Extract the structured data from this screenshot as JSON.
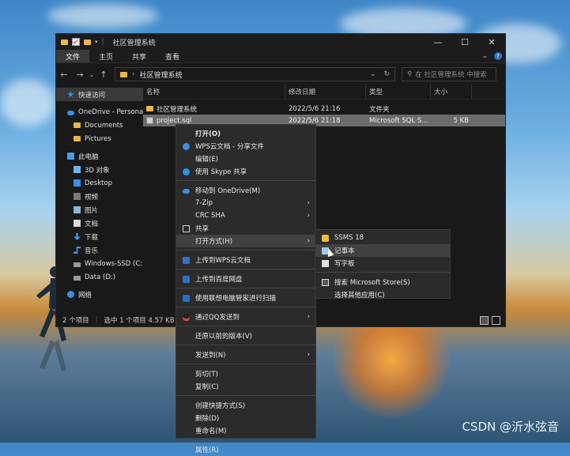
{
  "window": {
    "title": "社区管理系统",
    "controls": {
      "minimize": "—",
      "maximize": "☐",
      "close": "✕"
    }
  },
  "ribbon": {
    "tabs": [
      {
        "label": "文件",
        "active": true
      },
      {
        "label": "主页",
        "active": false
      },
      {
        "label": "共享",
        "active": false
      },
      {
        "label": "查看",
        "active": false
      }
    ]
  },
  "address": {
    "path": "社区管理系统",
    "search_placeholder": "在 社区管理系统 中搜索"
  },
  "nav_pane": {
    "items": [
      {
        "label": "快速访问",
        "icon": "star-icon",
        "selected": true
      },
      {
        "label": "OneDrive - Persona",
        "icon": "cloud-icon",
        "selected": false
      },
      {
        "label": "Documents",
        "icon": "folder-icon",
        "selected": false
      },
      {
        "label": "Pictures",
        "icon": "folder-icon",
        "selected": false
      },
      {
        "label": "此电脑",
        "icon": "computer-icon",
        "selected": false
      },
      {
        "label": "3D 对象",
        "icon": "cube-icon",
        "selected": false
      },
      {
        "label": "Desktop",
        "icon": "desktop-icon",
        "selected": false
      },
      {
        "label": "视频",
        "icon": "video-icon",
        "selected": false
      },
      {
        "label": "图片",
        "icon": "picture-icon",
        "selected": false
      },
      {
        "label": "文档",
        "icon": "document-icon",
        "selected": false
      },
      {
        "label": "下载",
        "icon": "download-icon",
        "selected": false
      },
      {
        "label": "音乐",
        "icon": "music-icon",
        "selected": false
      },
      {
        "label": "Windows-SSD (C:)",
        "icon": "drive-icon",
        "selected": false
      },
      {
        "label": "Data (D:)",
        "icon": "drive-icon",
        "selected": false
      },
      {
        "label": "网络",
        "icon": "network-icon",
        "selected": false
      }
    ]
  },
  "file_list": {
    "columns": [
      "名称",
      "修改日期",
      "类型",
      "大小"
    ],
    "rows": [
      {
        "name": "社区管理系统",
        "date": "2022/5/6 21:16",
        "type": "文件夹",
        "size": "",
        "icon": "folder-icon",
        "selected": false
      },
      {
        "name": "project.sql",
        "date": "2022/5/6 21:18",
        "type": "Microsoft SQL S...",
        "size": "5 KB",
        "icon": "sql-file-icon",
        "selected": true
      }
    ]
  },
  "status": {
    "item_count": "2 个项目",
    "selection": "选中 1 个项目  4.57 KB"
  },
  "context_menu": {
    "items": [
      {
        "label": "打开(O)",
        "bold": true,
        "icon": ""
      },
      {
        "label": "WPS云文档 - 分享文件",
        "icon": "wps-icon"
      },
      {
        "label": "编辑(E)",
        "icon": ""
      },
      {
        "label": "使用 Skype 共享",
        "icon": "skype-icon"
      },
      {
        "sep": true
      },
      {
        "label": "移动到 OneDrive(M)",
        "icon": "cloud-icon"
      },
      {
        "label": "7-Zip",
        "submenu": true,
        "icon": ""
      },
      {
        "label": "CRC SHA",
        "submenu": true,
        "icon": ""
      },
      {
        "label": "共享",
        "icon": "share-icon"
      },
      {
        "label": "打开方式(H)",
        "submenu": true,
        "highlighted": true,
        "icon": ""
      },
      {
        "sep": true
      },
      {
        "label": "上传到WPS云文档",
        "icon": "wps-upload-icon"
      },
      {
        "sep": true
      },
      {
        "label": "上传到百度网盘",
        "icon": "baidu-icon"
      },
      {
        "sep": true
      },
      {
        "label": "使用联想电脑管家进行扫描",
        "icon": "lenovo-icon"
      },
      {
        "sep": true
      },
      {
        "label": "通过QQ发送到",
        "submenu": true,
        "icon": "qq-icon"
      },
      {
        "sep": true
      },
      {
        "label": "还原以前的版本(V)",
        "icon": ""
      },
      {
        "sep": true
      },
      {
        "label": "发送到(N)",
        "submenu": true,
        "icon": ""
      },
      {
        "sep": true
      },
      {
        "label": "剪切(T)",
        "icon": ""
      },
      {
        "label": "复制(C)",
        "icon": ""
      },
      {
        "sep": true
      },
      {
        "label": "创建快捷方式(S)",
        "icon": ""
      },
      {
        "label": "删除(D)",
        "icon": ""
      },
      {
        "label": "重命名(M)",
        "icon": ""
      },
      {
        "sep": true
      },
      {
        "label": "属性(R)",
        "icon": ""
      }
    ]
  },
  "open_with_menu": {
    "items": [
      {
        "label": "SSMS 18",
        "icon": "ssms-icon"
      },
      {
        "label": "记事本",
        "icon": "notepad-icon",
        "highlighted": true
      },
      {
        "label": "写字板",
        "icon": "wordpad-icon"
      },
      {
        "sep": true
      },
      {
        "label": "搜索 Microsoft Store(S)",
        "icon": "store-icon"
      },
      {
        "label": "选择其他应用(C)",
        "icon": ""
      }
    ]
  },
  "watermark": "CSDN @沂水弦音",
  "colors": {
    "accent": "#2f73c4",
    "selection": "#6b6b6b",
    "menu_bg": "#2b2b2b",
    "window_bg": "#191919"
  }
}
